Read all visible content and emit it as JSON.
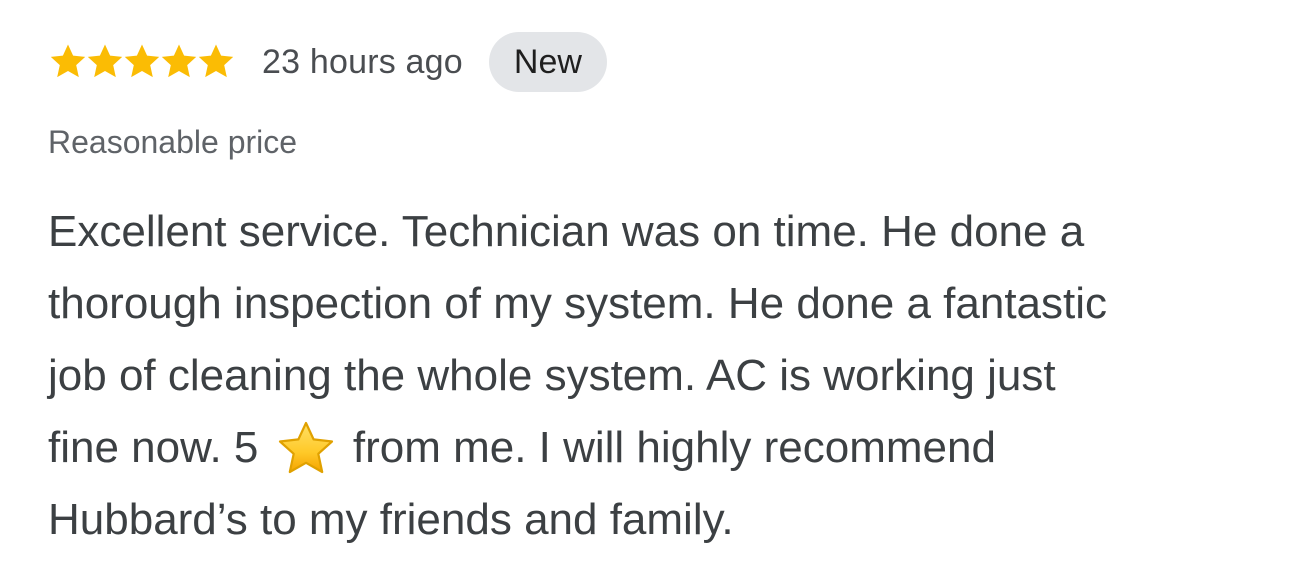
{
  "review": {
    "rating": 5,
    "rating_max": 5,
    "star_icon": "star-icon",
    "star_color": "#fbbc04",
    "timestamp": "23 hours ago",
    "badge_label": "New",
    "tag": "Reasonable price",
    "body": {
      "line1": "Excellent service. Technician was on time. He done a",
      "line2": "thorough inspection of my system. He done a fantastic",
      "line3": "job of cleaning the whole system. AC is working just",
      "line4_before": "fine now. 5",
      "line4_emoji": "star-emoji-icon",
      "line4_after": "from me. I will highly recommend",
      "line5": "Hubbard’s to my friends and family."
    }
  }
}
